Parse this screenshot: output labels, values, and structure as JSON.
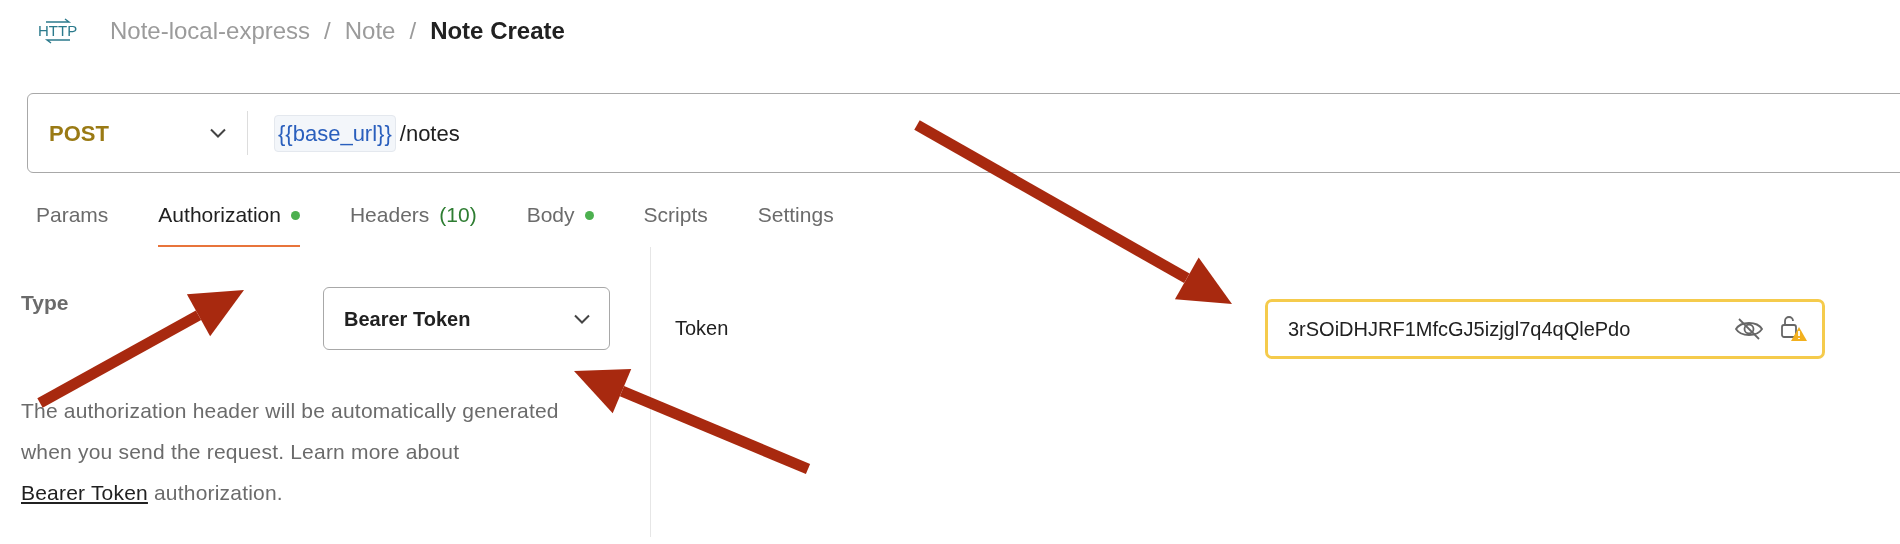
{
  "request_icon": {
    "label": "HTTP"
  },
  "breadcrumb": [
    {
      "label": "Note-local-express",
      "current": false
    },
    {
      "label": "Note",
      "current": false
    },
    {
      "label": "Note Create",
      "current": true
    }
  ],
  "breadcrumb_separators": [
    "/",
    "/"
  ],
  "request": {
    "method": "POST",
    "url_variable": "{{base_url}}",
    "url_path": "/notes"
  },
  "tabs": [
    {
      "label": "Params",
      "selected": false,
      "dot": false
    },
    {
      "label": "Authorization",
      "selected": true,
      "dot": true
    },
    {
      "label": "Headers",
      "count": "(10)",
      "selected": false,
      "dot": false
    },
    {
      "label": "Body",
      "selected": false,
      "dot": true
    },
    {
      "label": "Scripts",
      "selected": false,
      "dot": false
    },
    {
      "label": "Settings",
      "selected": false,
      "dot": false
    }
  ],
  "auth": {
    "type_label": "Type",
    "type_value": "Bearer Token",
    "description_before": "The authorization header will be automatically generated when you send the request. Learn more about",
    "link": "Bearer Token",
    "description_after": "authorization.",
    "token_label": "Token",
    "token_value": "3rSOiDHJRF1MfcGJ5izjgl7q4qQlePdo",
    "token_warning": true
  }
}
